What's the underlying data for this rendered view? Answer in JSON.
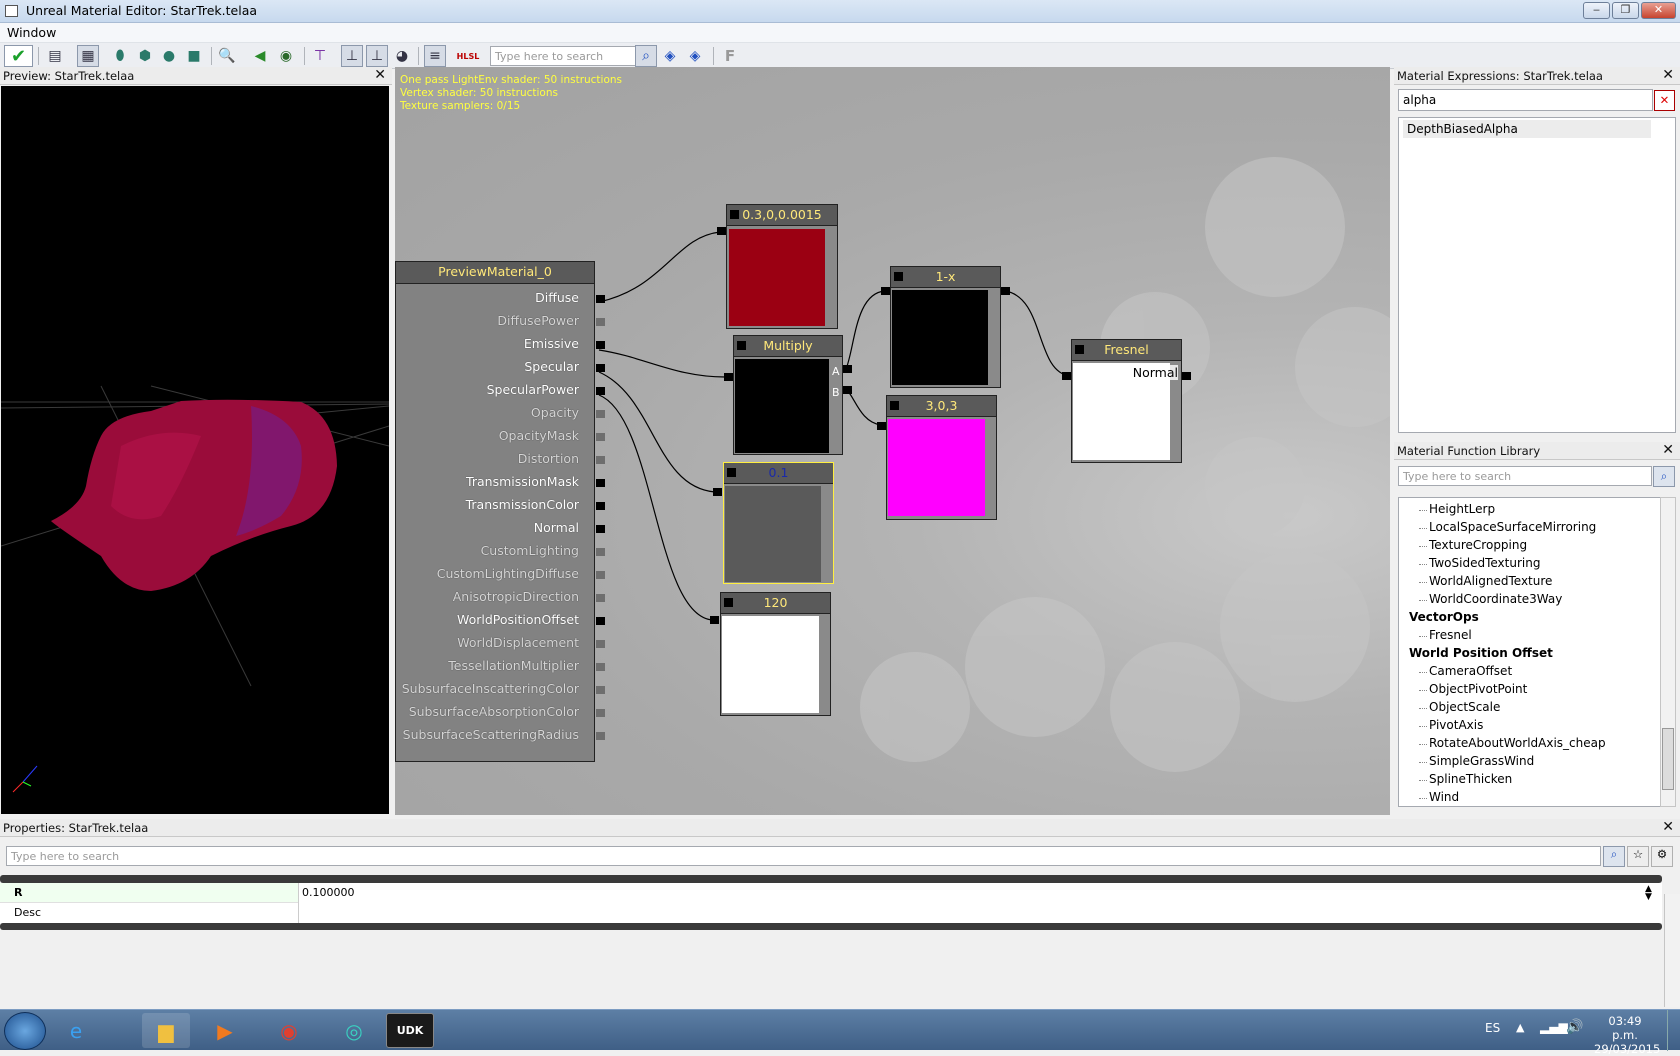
{
  "window": {
    "title": "Unreal Material Editor: StarTrek.telaa",
    "menu": [
      "Window"
    ]
  },
  "toolbar": {
    "search_placeholder": "Type here to search",
    "hlsl_label": "HLSL",
    "f_label": "F"
  },
  "preview": {
    "title": "Preview: StarTrek.telaa",
    "close": "✕"
  },
  "graph": {
    "stats": [
      "One pass LightEnv shader: 50 instructions",
      "Vertex shader: 50 instructions",
      "Texture samplers: 0/15"
    ],
    "material_node": {
      "title": "PreviewMaterial_0",
      "inputs": [
        "Diffuse",
        "DiffusePower",
        "Emissive",
        "Specular",
        "SpecularPower",
        "Opacity",
        "OpacityMask",
        "Distortion",
        "TransmissionMask",
        "TransmissionColor",
        "Normal",
        "CustomLighting",
        "CustomLightingDiffuse",
        "AnisotropicDirection",
        "WorldPositionOffset",
        "WorldDisplacement",
        "TessellationMultiplier",
        "SubsurfaceInscatteringColor",
        "SubsurfaceAbsorptionColor",
        "SubsurfaceScatteringRadius"
      ],
      "connected": [
        true,
        false,
        true,
        true,
        true,
        false,
        false,
        false,
        true,
        true,
        true,
        false,
        false,
        false,
        true,
        false,
        false,
        false,
        false,
        false
      ]
    },
    "nodes": {
      "const_diffuse": {
        "title": "0.3,0,0.0015",
        "color": "#9b0012"
      },
      "multiply": {
        "title": "Multiply",
        "pin_a": "A",
        "pin_b": "B",
        "color": "#000000"
      },
      "one_minus": {
        "title": "1-x",
        "color": "#000000"
      },
      "const_magenta": {
        "title": "3,0,3",
        "color": "#ff00ff"
      },
      "fresnel": {
        "title": "Fresnel",
        "pin_normal": "Normal",
        "color": "#ffffff"
      },
      "const_01": {
        "title": "0.1",
        "color": "#5a5a5a"
      },
      "const_120": {
        "title": "120",
        "color": "#ffffff"
      }
    }
  },
  "material_expressions": {
    "title": "Material Expressions: StarTrek.telaa",
    "search_value": "alpha",
    "results": [
      "DepthBiasedAlpha"
    ]
  },
  "function_library": {
    "title": "Material Function Library",
    "search_placeholder": "Type here to search",
    "tree": [
      {
        "type": "item",
        "label": "HeightLerp"
      },
      {
        "type": "item",
        "label": "LocalSpaceSurfaceMirroring"
      },
      {
        "type": "item",
        "label": "TextureCropping"
      },
      {
        "type": "item",
        "label": "TwoSidedTexturing"
      },
      {
        "type": "item",
        "label": "WorldAlignedTexture"
      },
      {
        "type": "item",
        "label": "WorldCoordinate3Way"
      },
      {
        "type": "cat",
        "label": "VectorOps"
      },
      {
        "type": "item",
        "label": "Fresnel"
      },
      {
        "type": "cat",
        "label": "World Position Offset"
      },
      {
        "type": "item",
        "label": "CameraOffset"
      },
      {
        "type": "item",
        "label": "ObjectPivotPoint"
      },
      {
        "type": "item",
        "label": "ObjectScale"
      },
      {
        "type": "item",
        "label": "PivotAxis"
      },
      {
        "type": "item",
        "label": "RotateAboutWorldAxis_cheap"
      },
      {
        "type": "item",
        "label": "SimpleGrassWind"
      },
      {
        "type": "item",
        "label": "SplineThicken"
      },
      {
        "type": "item",
        "label": "Wind"
      }
    ]
  },
  "properties": {
    "title": "Properties: StarTrek.telaa",
    "search_placeholder": "Type here to search",
    "rows": [
      {
        "name": "R",
        "value": "0.100000"
      },
      {
        "name": "Desc",
        "value": ""
      }
    ]
  },
  "taskbar": {
    "language": "ES",
    "time": "03:49 p.m.",
    "date": "29/03/2015",
    "udk_label": "UDK"
  }
}
